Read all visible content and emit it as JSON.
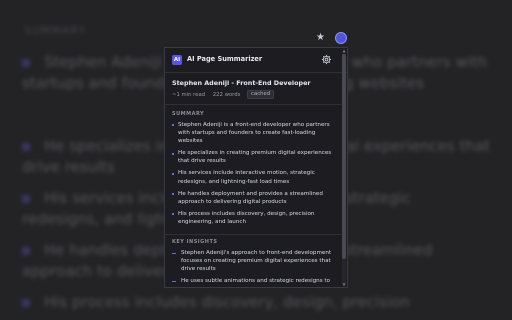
{
  "background": {
    "heading": "SUMMARY",
    "items": [
      "Stephen Adeniji is a front-end developer who partners with startups and founders to create fast-loading websites",
      "He specializes in creating premium digital experiences that drive results",
      "His services include interactive motion, strategic redesigns, and lightning-fast load times",
      "He handles deployment and provides a streamlined approach to delivering digital products",
      "His process includes discovery, design, precision"
    ]
  },
  "popup": {
    "app_title": "AI Page Summarizer",
    "logo_text": "AI",
    "page_title": "Stephen Adeniji - Front-End Developer",
    "meta": {
      "read_time": "~1 min read",
      "words": "222 words",
      "badge": "cached"
    },
    "summary_label": "SUMMARY",
    "summary": [
      "Stephen Adeniji is a front-end developer who partners with startups and founders to create fast-loading websites",
      "He specializes in creating premium digital experiences that drive results",
      "His services include interactive motion, strategic redesigns, and lightning-fast load times",
      "He handles deployment and provides a streamlined approach to delivering digital products",
      "His process includes discovery, design, precision engineering, and launch"
    ],
    "insights_label": "KEY INSIGHTS",
    "insights": [
      "Stephen Adeniji's approach to front-end development focuses on creating premium digital experiences that drive results",
      "He uses subtle animations and strategic redesigns to"
    ]
  },
  "icons": {
    "logo": "ai-logo-icon",
    "settings": "gear-icon",
    "bookmark": "star-icon",
    "extension": "extension-icon"
  },
  "colors": {
    "accent": "#5b54e8",
    "popup_bg": "#1c1c21",
    "text": "#dcdce6",
    "muted": "#9b9ba8"
  }
}
